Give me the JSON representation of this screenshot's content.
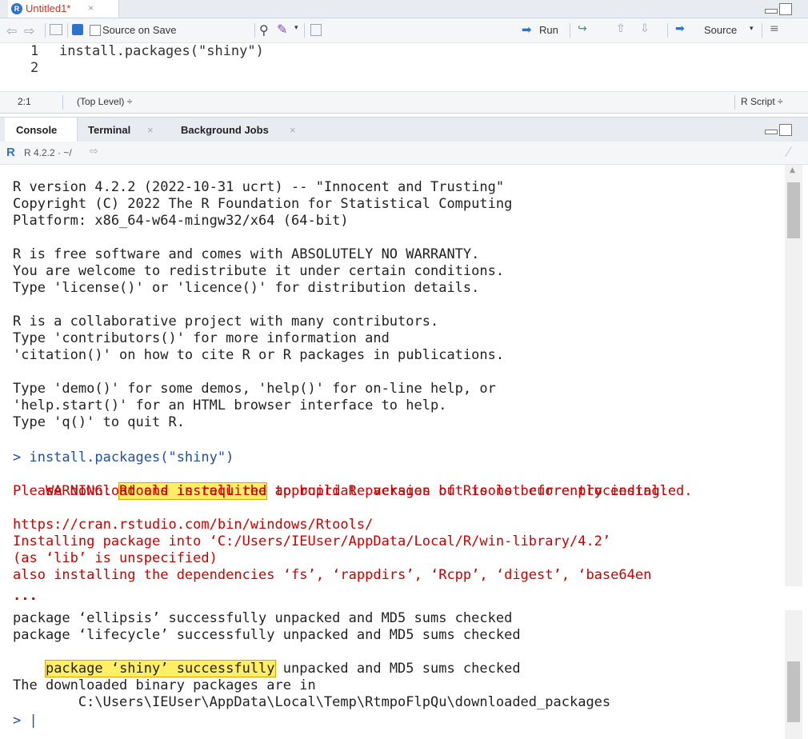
{
  "editor": {
    "tab_title": "Untitled1*",
    "toolbar": {
      "source_on_save": "Source on Save",
      "run": "Run",
      "source": "Source"
    },
    "lines": [
      {
        "num": "1",
        "code": "install.packages(\"shiny\")"
      },
      {
        "num": "2",
        "code": ""
      }
    ],
    "status": {
      "position": "2:1",
      "scope": "(Top Level) ÷",
      "file_type": "R Script ÷"
    }
  },
  "console": {
    "tabs": [
      {
        "label": "Console"
      },
      {
        "label": "Terminal"
      },
      {
        "label": "Background Jobs"
      }
    ],
    "r_version": "R 4.2.2 · ~/",
    "output": {
      "startup": [
        "R version 4.2.2 (2022-10-31 ucrt) -- \"Innocent and Trusting\"",
        "Copyright (C) 2022 The R Foundation for Statistical Computing",
        "Platform: x86_64-w64-mingw32/x64 (64-bit)",
        "",
        "R is free software and comes with ABSOLUTELY NO WARRANTY.",
        "You are welcome to redistribute it under certain conditions.",
        "Type 'license()' or 'licence()' for distribution details.",
        "",
        "R is a collaborative project with many contributors.",
        "Type 'contributors()' for more information and",
        "'citation()' on how to cite R or R packages in publications.",
        "",
        "Type 'demo()' for some demos, 'help()' for on-line help, or",
        "'help.start()' for an HTML browser interface to help.",
        "Type 'q()' to quit R."
      ],
      "command": "> install.packages(\"shiny\")",
      "warning_prefix": "WARNING: ",
      "warning_highlight": "Rtools is required",
      "warning_rest": " to build R packages but is not currently installed.",
      "warning_line2": "Please download and install the appropriate version of Rtools before proceeding:",
      "install_lines": [
        "https://cran.rstudio.com/bin/windows/Rtools/",
        "Installing package into ‘C:/Users/IEUser/AppData/Local/R/win-library/4.2’",
        "(as ‘lib’ is unspecified)",
        "also installing the dependencies ‘fs’, ‘rappdirs’, ‘Rcpp’, ‘digest’, ‘base64en"
      ],
      "ellipsis": "...",
      "pkg_lines": [
        "package ‘ellipsis’ successfully unpacked and MD5 sums checked",
        "package ‘lifecycle’ successfully unpacked and MD5 sums checked"
      ],
      "shiny_highlight": "package ‘shiny’ successfully",
      "shiny_rest": " unpacked and MD5 sums checked",
      "download_line1": "The downloaded binary packages are in",
      "download_line2": "        C:\\Users\\IEUser\\AppData\\Local\\Temp\\RtmpoFlpQu\\downloaded_packages",
      "prompt": "> |"
    }
  },
  "colors": {
    "warning": "#cc0000",
    "highlight": "#ffee66",
    "command": "#1f4fa8",
    "pane_bar": "#e8ecf1"
  }
}
